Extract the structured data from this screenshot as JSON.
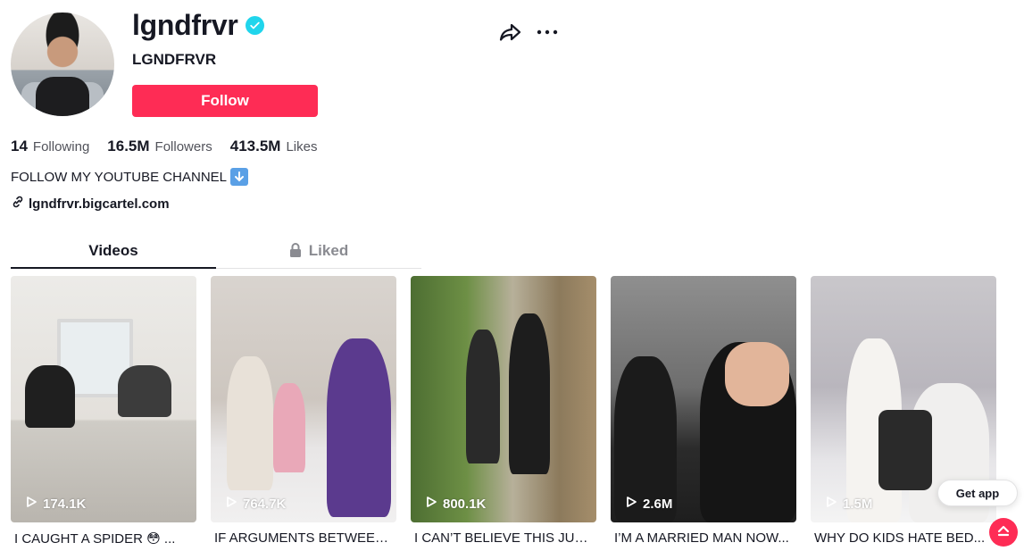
{
  "profile": {
    "username": "lgndfrvr",
    "nickname": "LGNDFRVR",
    "follow_label": "Follow",
    "bio": "FOLLOW MY YOUTUBE CHANNEL",
    "bio_emoji_icon": "down-arrow-emoji-icon",
    "link": "lgndfrvr.bigcartel.com",
    "verified_color": "#20D5EC"
  },
  "stats": {
    "following_count": "14",
    "following_label": "Following",
    "followers_count": "16.5M",
    "followers_label": "Followers",
    "likes_count": "413.5M",
    "likes_label": "Likes"
  },
  "tabs": {
    "videos": "Videos",
    "liked": "Liked"
  },
  "videos": [
    {
      "views": "174.1K",
      "caption": "I CAUGHT A SPIDER 😳 ..."
    },
    {
      "views": "764.7K",
      "caption": "IF ARGUMENTS BETWEEN..."
    },
    {
      "views": "800.1K",
      "caption": "I CAN’T BELIEVE THIS JUS..."
    },
    {
      "views": "2.6M",
      "caption": "I’M A MARRIED MAN NOW..."
    },
    {
      "views": "1.5M",
      "caption": "WHY DO KIDS HATE BED..."
    }
  ],
  "floating": {
    "get_app": "Get app"
  },
  "colors": {
    "accent": "#FE2C55",
    "text": "#161823",
    "muted": "#8A8B91"
  }
}
